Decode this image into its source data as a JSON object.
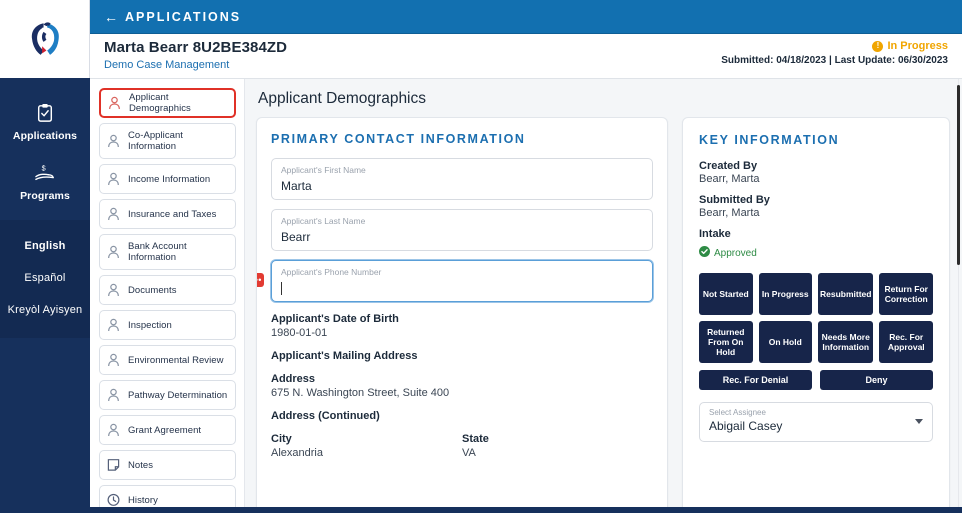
{
  "rail": {
    "logo_alt": "agency-bird-logo",
    "nav": [
      {
        "label": "Applications",
        "icon": "clipboard-check-icon"
      },
      {
        "label": "Programs",
        "icon": "hand-money-icon"
      }
    ],
    "languages": [
      {
        "label": "English",
        "active": true
      },
      {
        "label": "Español",
        "active": false
      },
      {
        "label": "Kreyòl Ayisyen",
        "active": false
      }
    ]
  },
  "topbar": {
    "back_label": "APPLICATIONS",
    "back_arrow": "←"
  },
  "subheader": {
    "case_title": "Marta Bearr 8U2BE384ZD",
    "case_subtitle": "Demo Case Management",
    "status_badge": "In Progress",
    "status_icon": "!",
    "status_color": "#f0a500",
    "timestamps": "Submitted: 04/18/2023 | Last Update: 06/30/2023"
  },
  "nav_items": [
    {
      "label": "Applicant Demographics",
      "icon": "person-icon",
      "active": true
    },
    {
      "label": "Co-Applicant Information",
      "icon": "person-icon",
      "active": false
    },
    {
      "label": "Income Information",
      "icon": "person-icon",
      "active": false
    },
    {
      "label": "Insurance and Taxes",
      "icon": "person-icon",
      "active": false
    },
    {
      "label": "Bank Account Information",
      "icon": "person-icon",
      "active": false
    },
    {
      "label": "Documents",
      "icon": "person-icon",
      "active": false
    },
    {
      "label": "Inspection",
      "icon": "person-icon",
      "active": false
    },
    {
      "label": "Environmental Review",
      "icon": "person-icon",
      "active": false
    },
    {
      "label": "Pathway Determination",
      "icon": "person-icon",
      "active": false
    },
    {
      "label": "Grant Agreement",
      "icon": "person-icon",
      "active": false
    },
    {
      "label": "Notes",
      "icon": "note-icon",
      "active": false
    },
    {
      "label": "History",
      "icon": "clock-icon",
      "active": false
    }
  ],
  "main": {
    "page_title": "Applicant Demographics",
    "section_title": "PRIMARY CONTACT INFORMATION",
    "fields": [
      {
        "label": "Applicant's First Name",
        "value": "Marta",
        "focused": false,
        "flagged": false
      },
      {
        "label": "Applicant's Last Name",
        "value": "Bearr",
        "focused": false,
        "flagged": false
      },
      {
        "label": "Applicant's Phone Number",
        "value": "",
        "focused": true,
        "flagged": true
      }
    ],
    "readonly": [
      {
        "label": "Applicant's Date of Birth",
        "value": "1980-01-01"
      },
      {
        "label": "Applicant's Mailing Address",
        "value": ""
      },
      {
        "label": "Address",
        "value": "675 N. Washington Street, Suite 400"
      },
      {
        "label": "Address (Continued)",
        "value": ""
      }
    ],
    "city_state": {
      "city_label": "City",
      "city_value": "Alexandria",
      "state_label": "State",
      "state_value": "VA"
    }
  },
  "key_info": {
    "title": "KEY INFORMATION",
    "rows": [
      {
        "label": "Created By",
        "value": "Bearr, Marta"
      },
      {
        "label": "Submitted By",
        "value": "Bearr, Marta"
      }
    ],
    "intake_label": "Intake",
    "intake_status": "Approved",
    "intake_status_color": "#2e8b45",
    "status_buttons": [
      "Not Started",
      "In Progress",
      "Resubmitted",
      "Return For Correction",
      "Returned From On Hold",
      "On Hold",
      "Needs More Information",
      "Rec. For Approval"
    ],
    "wide_buttons": [
      "Rec. For Denial",
      "Deny"
    ],
    "button_color": "#17254a",
    "assignee": {
      "label": "Select Assignee",
      "value": "Abigail Casey"
    }
  }
}
